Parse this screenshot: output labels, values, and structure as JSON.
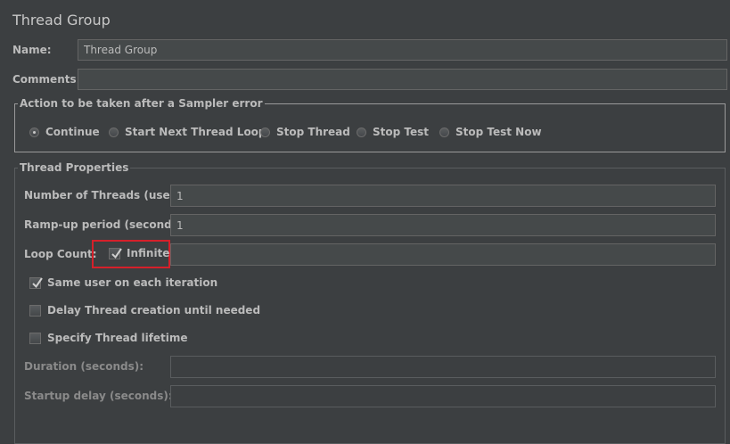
{
  "header": {
    "title": "Thread Group"
  },
  "form": {
    "name_label": "Name:",
    "name_value": "Thread Group",
    "comments_label": "Comments:",
    "comments_value": ""
  },
  "sampler_error": {
    "legend": "Action to be taken after a Sampler error",
    "options": [
      {
        "label": "Continue",
        "selected": true
      },
      {
        "label": "Start Next Thread Loop",
        "selected": false
      },
      {
        "label": "Stop Thread",
        "selected": false
      },
      {
        "label": "Stop Test",
        "selected": false
      },
      {
        "label": "Stop Test Now",
        "selected": false
      }
    ]
  },
  "thread_properties": {
    "legend": "Thread Properties",
    "threads_label": "Number of Threads (users):",
    "threads_value": "1",
    "rampup_label": "Ramp-up period (seconds):",
    "rampup_value": "1",
    "loop_label": "Loop Count:",
    "infinite_label": "Infinite",
    "infinite_checked": true,
    "loop_value": "",
    "same_user_label": "Same user on each iteration",
    "same_user_checked": true,
    "delay_label": "Delay Thread creation until needed",
    "delay_checked": false,
    "lifetime_label": "Specify Thread lifetime",
    "lifetime_checked": false,
    "duration_label": "Duration (seconds):",
    "duration_value": "",
    "startup_label": "Startup delay (seconds):",
    "startup_value": ""
  },
  "colors": {
    "background": "#3c3f41",
    "field": "#45494a",
    "highlight": "#d6202a"
  }
}
